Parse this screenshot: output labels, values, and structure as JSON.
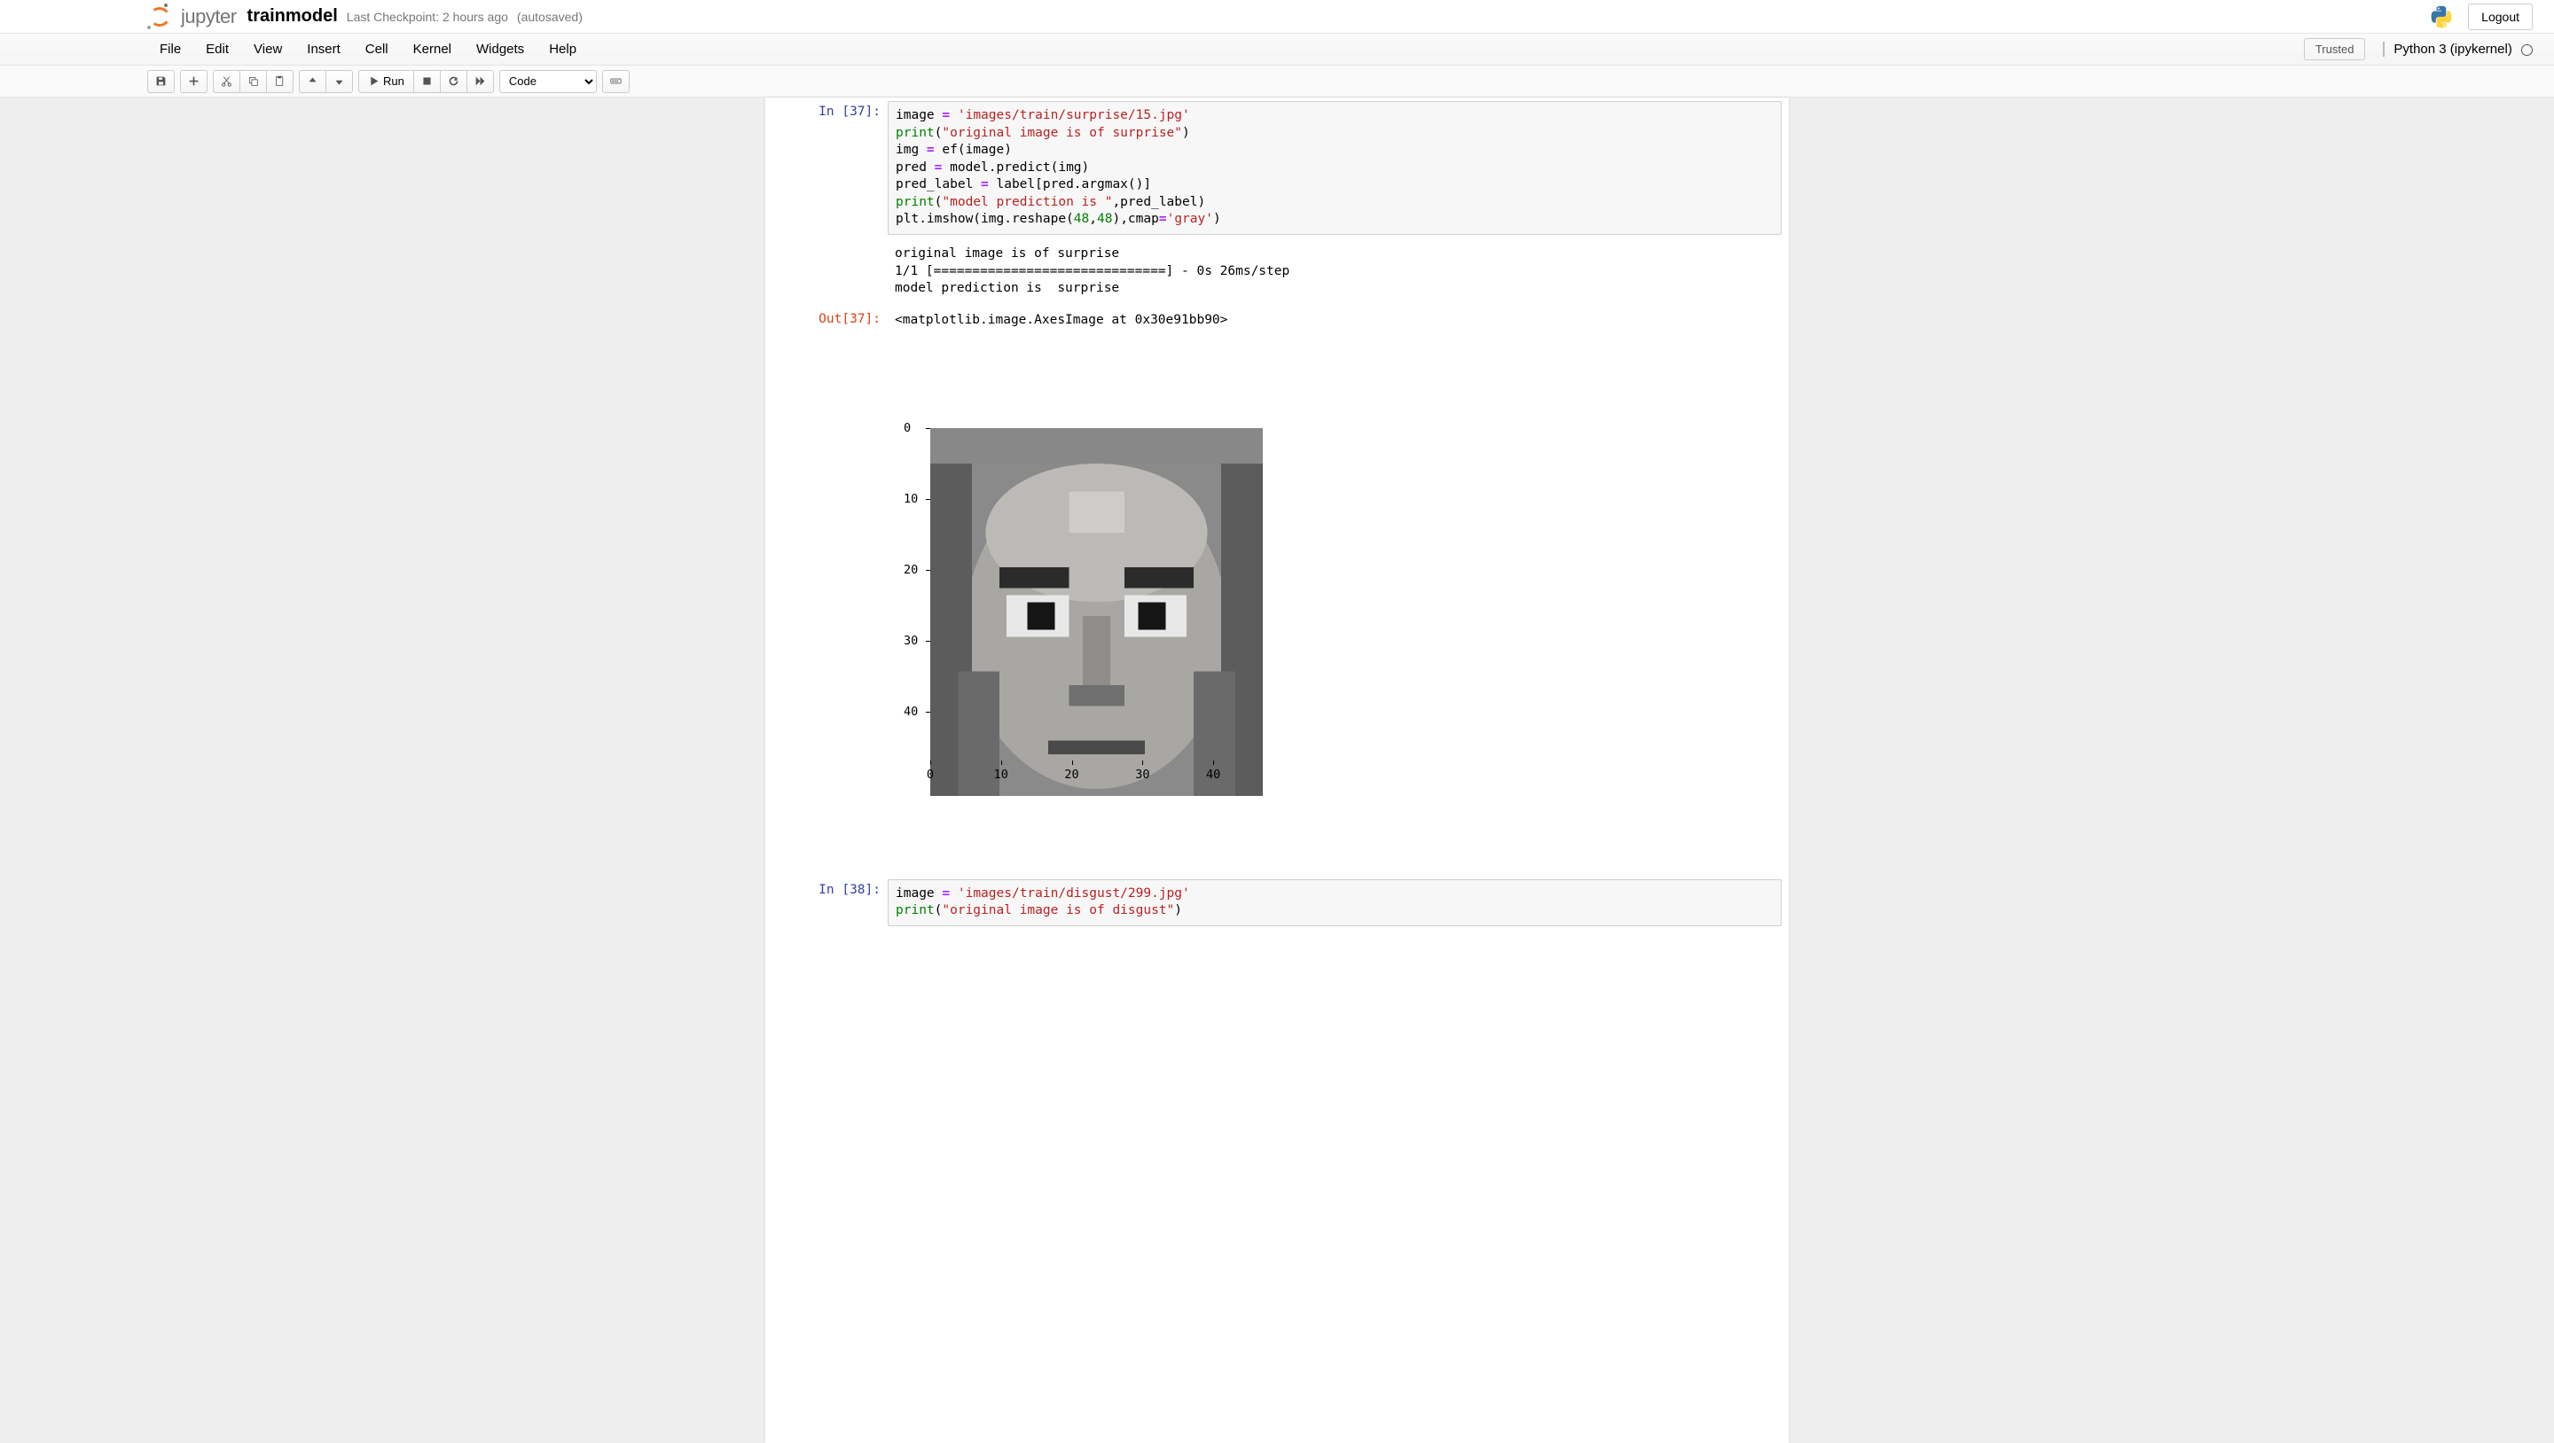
{
  "header": {
    "brand": "jupyter",
    "notebook_name": "trainmodel",
    "checkpoint": "Last Checkpoint: 2 hours ago",
    "autosaved": "(autosaved)",
    "logout": "Logout"
  },
  "menu": {
    "items": [
      "File",
      "Edit",
      "View",
      "Insert",
      "Cell",
      "Kernel",
      "Widgets",
      "Help"
    ],
    "trusted": "Trusted",
    "kernel": "Python 3 (ipykernel)"
  },
  "toolbar": {
    "run_label": "Run",
    "cell_type": "Code"
  },
  "cells": [
    {
      "in_prompt": "In [37]:",
      "code_html": "image <span class='op'>=</span> <span class='str'>'images/train/surprise/15.jpg'</span>\n<span class='call'>print</span>(<span class='str'>\"original image is of surprise\"</span>)\nimg <span class='op'>=</span> ef(image)\npred <span class='op'>=</span> model.predict(img)\npred_label <span class='op'>=</span> label[pred.argmax()]\n<span class='call'>print</span>(<span class='str'>\"model prediction is \"</span>,pred_label)\nplt.imshow(img.reshape(<span class='num'>48</span>,<span class='num'>48</span>),cmap<span class='op'>=</span><span class='str'>'gray'</span>)",
      "stdout": "original image is of surprise\n1/1 [==============================] - 0s 26ms/step\nmodel prediction is  surprise",
      "out_prompt": "Out[37]:",
      "out_text": "<matplotlib.image.AxesImage at 0x30e91bb90>"
    },
    {
      "in_prompt": "In [38]:",
      "code_html": "image <span class='op'>=</span> <span class='str'>'images/train/disgust/299.jpg'</span>\n<span class='call'>print</span>(<span class='str'>\"original image is of disgust\"</span>)"
    }
  ],
  "chart_data": {
    "type": "heatmap",
    "title": "",
    "xlabel": "",
    "ylabel": "",
    "xlim": [
      0,
      47
    ],
    "ylim": [
      47,
      0
    ],
    "xticks": [
      0,
      10,
      20,
      30,
      40
    ],
    "yticks": [
      0,
      10,
      20,
      30,
      40
    ],
    "cmap": "gray",
    "shape": [
      48,
      48
    ],
    "description": "48x48 grayscale face image (surprise emotion) displayed via plt.imshow"
  }
}
